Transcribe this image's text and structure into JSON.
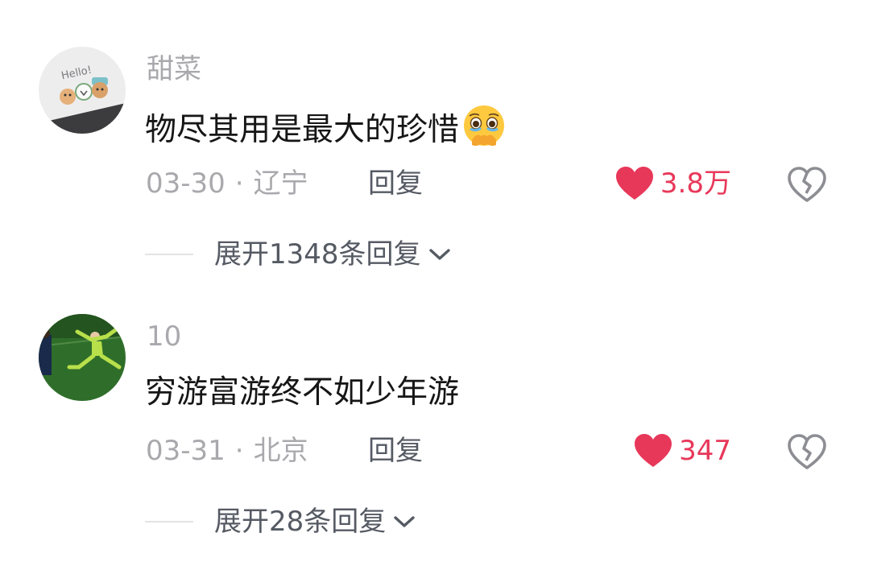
{
  "comments": [
    {
      "username": "甜菜",
      "avatar_icon": "avatar-hello-cartoon",
      "text": "物尽其用是最大的珍惜",
      "emoji_icon": "holding-back-tears-emoji",
      "date": "03-30",
      "separator": "·",
      "location": "辽宁",
      "reply_label": "回复",
      "like_count": "3.8万",
      "expand_label": "展开1348条回复"
    },
    {
      "username": "10",
      "avatar_icon": "avatar-goalkeeper-photo",
      "text": "穷游富游终不如少年游",
      "date": "03-31",
      "separator": "·",
      "location": "北京",
      "reply_label": "回复",
      "like_count": "347",
      "expand_label": "展开28条回复"
    }
  ],
  "colors": {
    "like_red": "#e8385a",
    "muted_gray": "#a9a9ad",
    "action_gray": "#555a63",
    "text_black": "#161616"
  }
}
